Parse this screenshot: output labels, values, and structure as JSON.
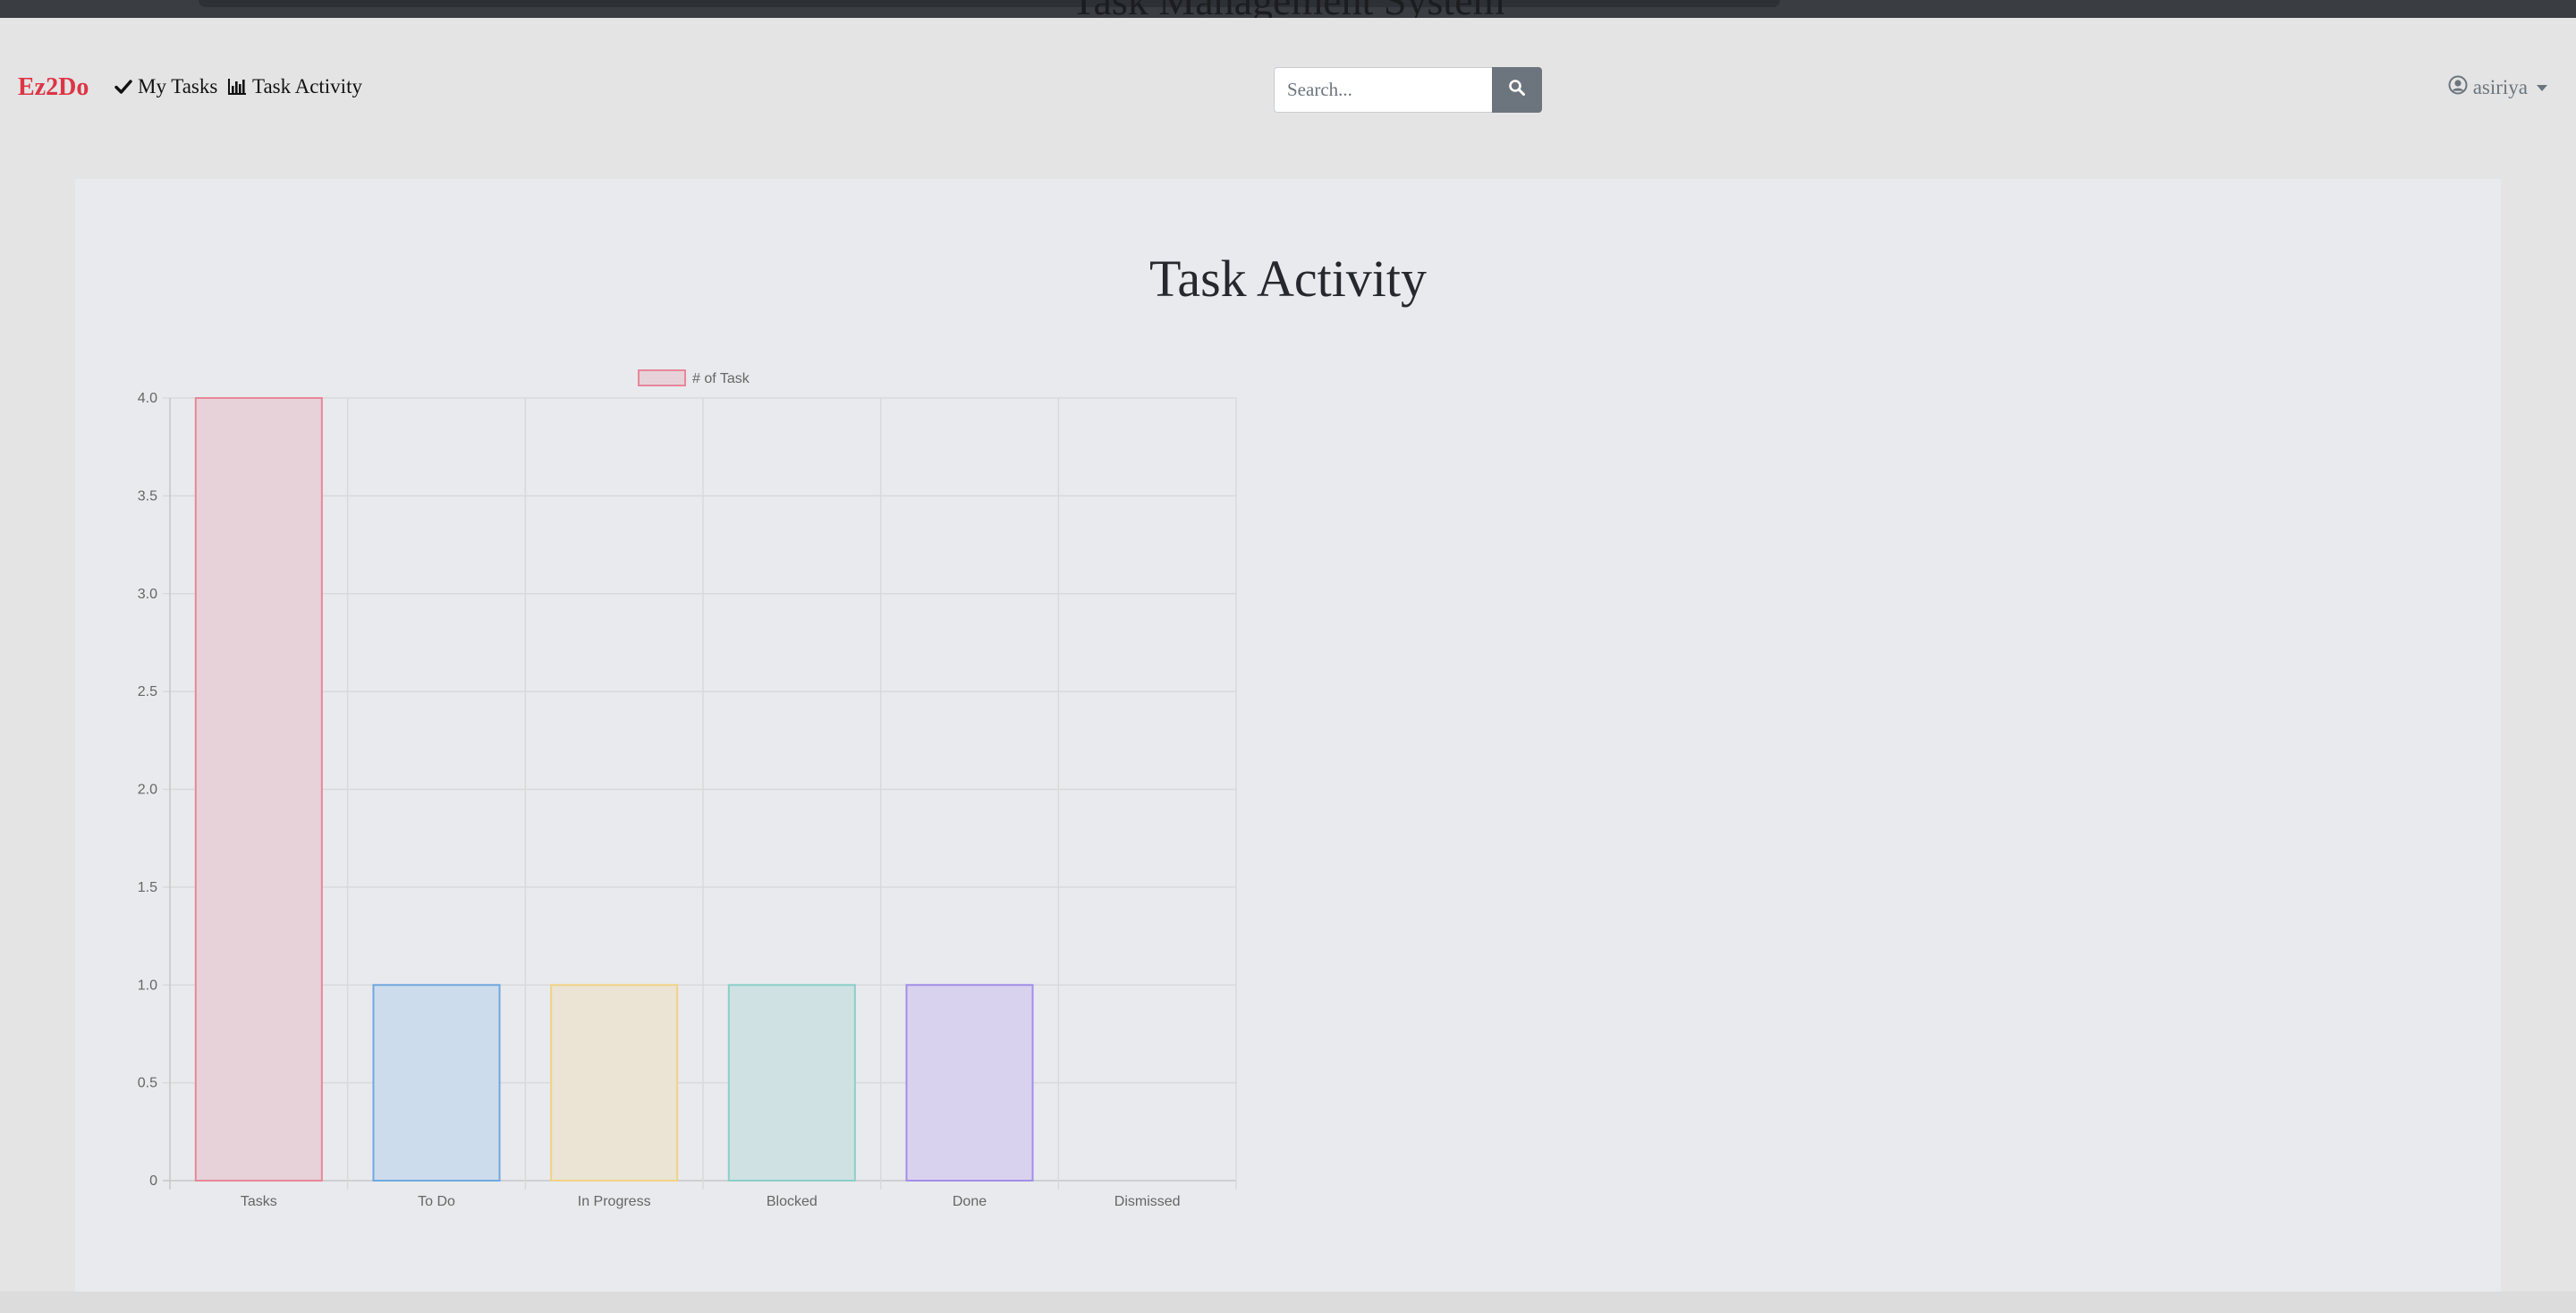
{
  "header": {
    "partial_title": "Task Management System"
  },
  "navbar": {
    "brand": "Ez2Do",
    "links": [
      {
        "label": "My Tasks",
        "icon": "check-icon"
      },
      {
        "label": "Task Activity",
        "icon": "bar-chart-icon"
      }
    ],
    "search": {
      "placeholder": "Search...",
      "button_icon": "search-icon"
    },
    "user": {
      "name": "asiriya",
      "icon": "user-circle-icon"
    }
  },
  "main": {
    "title": "Task Activity"
  },
  "colors": {
    "brand": "#dc3545",
    "search_button": "#6c757d"
  },
  "chart_data": {
    "type": "bar",
    "legend": {
      "label": "# of Task",
      "position": "top"
    },
    "categories": [
      "Tasks",
      "To Do",
      "In Progress",
      "Blocked",
      "Done",
      "Dismissed"
    ],
    "series": [
      {
        "name": "# of Task",
        "values": [
          4,
          1,
          1,
          1,
          1,
          0
        ]
      }
    ],
    "bar_colors": [
      {
        "fill": "#e7d2d9",
        "stroke": "#e8879a"
      },
      {
        "fill": "#cddcec",
        "stroke": "#6fa8e0"
      },
      {
        "fill": "#ebe3d3",
        "stroke": "#f2d287"
      },
      {
        "fill": "#cfe1e3",
        "stroke": "#8ccfc9"
      },
      {
        "fill": "#d8d2ef",
        "stroke": "#a48ee8"
      },
      {
        "fill": "#e4e4e8",
        "stroke": "#c9cbcf"
      }
    ],
    "y_ticks": [
      "0",
      "0.5",
      "1.0",
      "1.5",
      "2.0",
      "2.5",
      "3.0",
      "3.5",
      "4.0"
    ],
    "ylim": [
      0,
      4
    ],
    "grid": true
  }
}
